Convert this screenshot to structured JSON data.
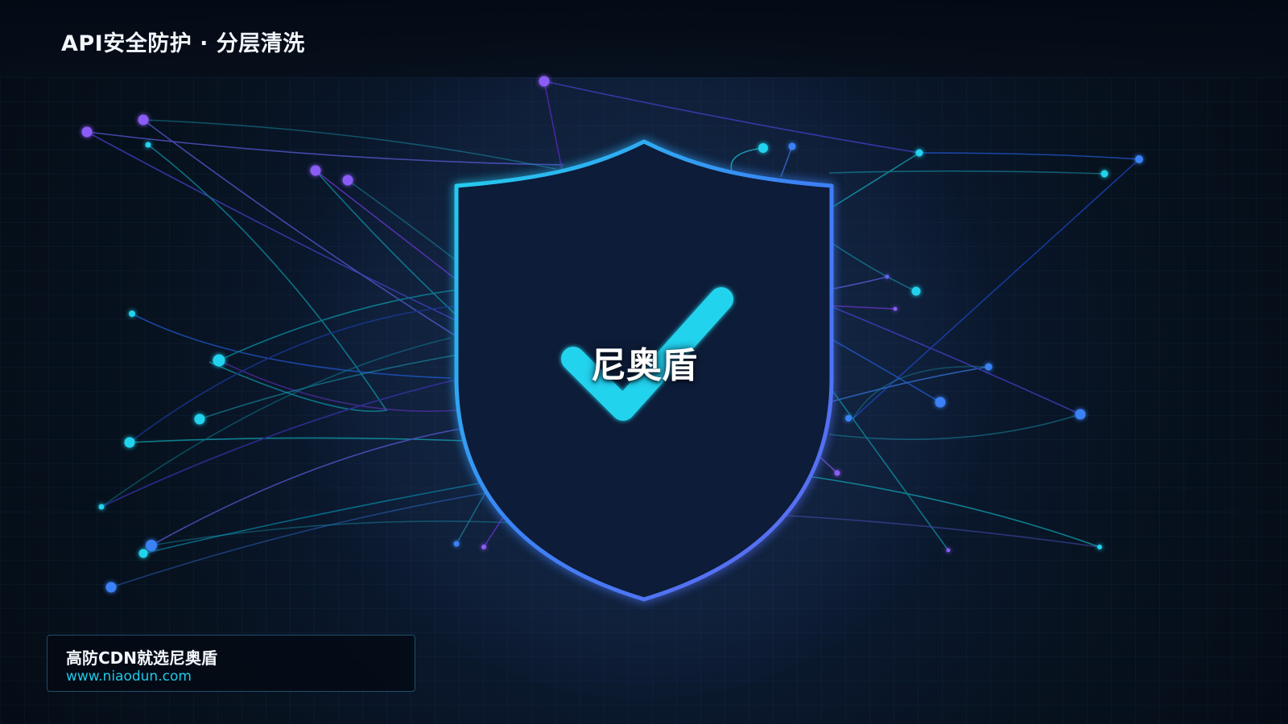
{
  "header": {
    "title": "API安全防护 · 分层清洗"
  },
  "shield": {
    "brand_name": "尼奥盾",
    "icon": "shield-check-icon"
  },
  "promo": {
    "headline": "高防CDN就选尼奥盾",
    "url": "www.niaodun.com"
  },
  "colors": {
    "background": "#07121f",
    "cyan": "#22d3ee",
    "blue": "#3b82f6",
    "violet": "#6366f1",
    "purple": "#8b5cf6"
  }
}
